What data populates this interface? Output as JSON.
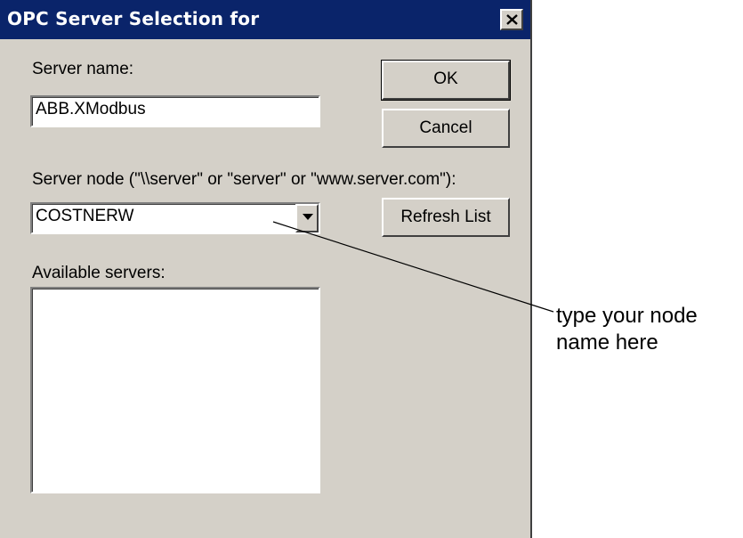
{
  "window": {
    "title": "OPC Server Selection for",
    "close_symbol": "close-icon"
  },
  "server_name": {
    "label": "Server name:",
    "value": "ABB.XModbus"
  },
  "buttons": {
    "ok": "OK",
    "cancel": "Cancel",
    "refresh": "Refresh List"
  },
  "server_node": {
    "label": "Server node (\"\\\\server\" or \"server\" or \"www.server.com\"):",
    "value": "COSTNERW",
    "dropdown_icon": "chevron-down-icon"
  },
  "available_servers": {
    "label": "Available servers:",
    "items": []
  },
  "annotation": {
    "line1": "type your node",
    "line2": "name here"
  },
  "colors": {
    "titlebar": "#0a246a",
    "dialog_bg": "#d4d0c8"
  }
}
